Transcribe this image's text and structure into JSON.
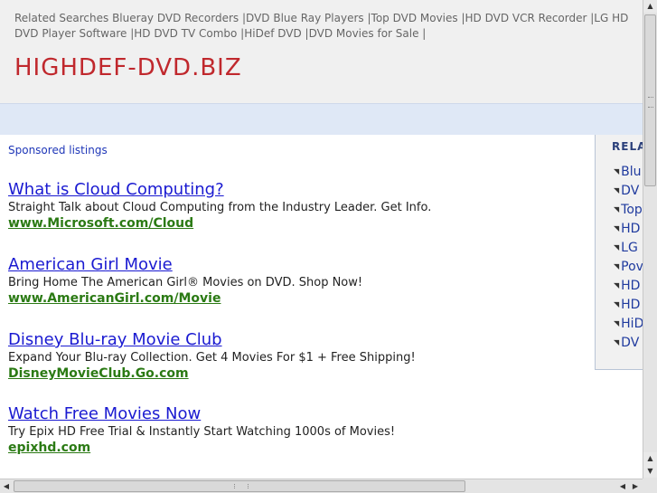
{
  "related_searches": {
    "label": "Related Searches",
    "links": [
      "Blueray DVD Recorders",
      "DVD Blue Ray Players",
      "Top DVD Movies",
      "HD DVD VCR Recorder",
      "LG HD DVD",
      "Player Software",
      "HD DVD TV Combo",
      "HiDef DVD",
      "DVD Movies for Sale"
    ],
    "separator": "|"
  },
  "site_title": "HIGHDEF-DVD.BIZ",
  "sponsored_label": "Sponsored listings",
  "ads": [
    {
      "title": "What is Cloud Computing?",
      "description": "Straight Talk about Cloud Computing from the Industry Leader. Get Info.",
      "url": "www.Microsoft.com/Cloud"
    },
    {
      "title": "American Girl Movie",
      "description": "Bring Home The American Girl® Movies on DVD. Shop Now!",
      "url": "www.AmericanGirl.com/Movie"
    },
    {
      "title": "Disney Blu-ray Movie Club",
      "description": "Expand Your Blu-ray Collection. Get 4 Movies For $1 + Free Shipping!",
      "url": "DisneyMovieClub.Go.com"
    },
    {
      "title": "Watch Free Movies Now",
      "description": "Try Epix HD Free Trial & Instantly Start Watching 1000s of Movies!",
      "url": "epixhd.com"
    }
  ],
  "sidebar": {
    "heading": "RELA",
    "items": [
      "Blu",
      "DV",
      "Top",
      "HD",
      "LG",
      "Pov",
      "HD",
      "HD",
      "HiD",
      "DV"
    ]
  },
  "icons": {
    "arrow": "bullet-arrow-icon",
    "scroll_up": "scroll-up-icon",
    "scroll_down": "scroll-down-icon",
    "scroll_left": "scroll-left-icon",
    "scroll_right": "scroll-right-icon"
  },
  "colors": {
    "title_red": "#c0282d",
    "link_blue": "#1a1ad1",
    "url_green": "#2b7a14",
    "band_blue": "#dfe8f6"
  }
}
